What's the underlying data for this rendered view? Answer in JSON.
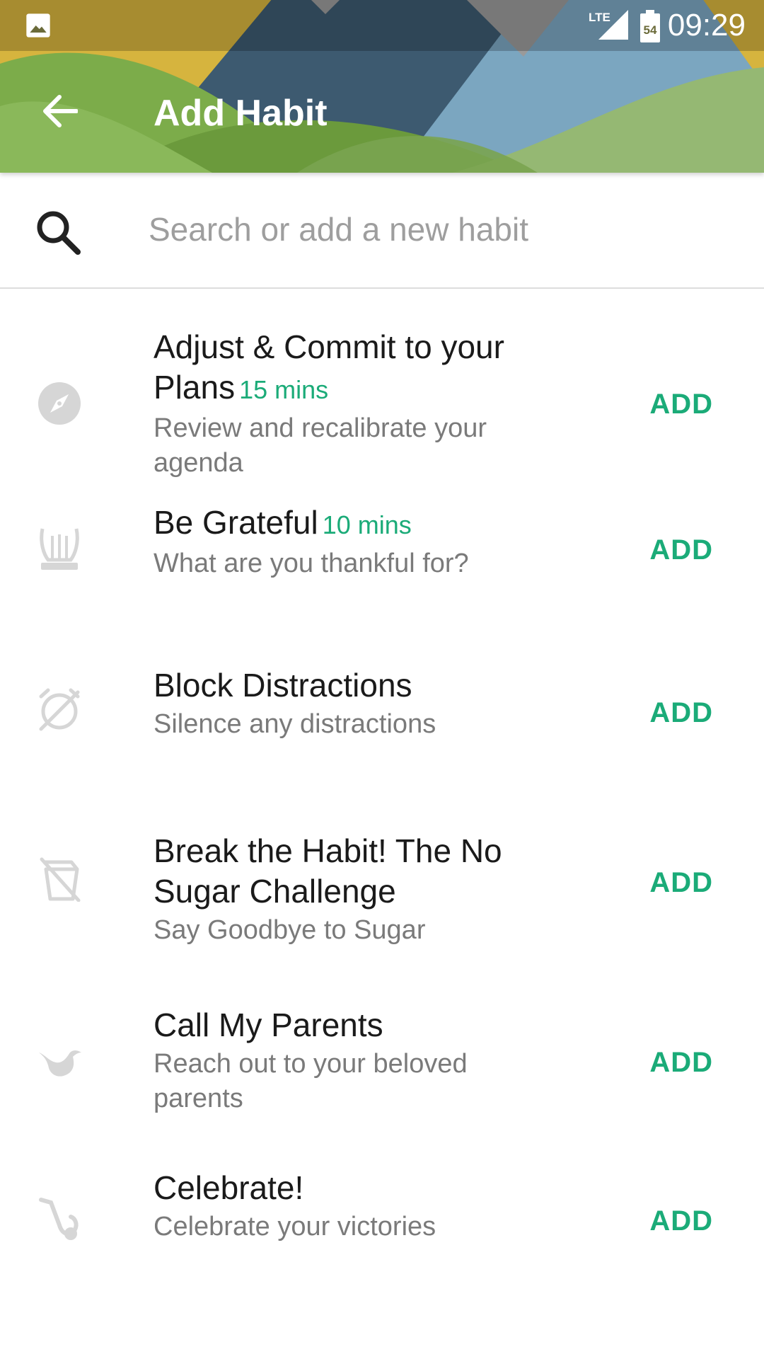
{
  "status_bar": {
    "time": "09:29",
    "network_label": "LTE",
    "battery_level": "54",
    "icons": [
      "image-icon",
      "lte-signal-icon",
      "battery-icon"
    ]
  },
  "toolbar": {
    "title": "Add Habit",
    "back_icon": "arrow-back-icon"
  },
  "search": {
    "placeholder": "Search or add a new habit",
    "value": ""
  },
  "colors": {
    "accent": "#1bab78",
    "title_text": "#1a1a1a",
    "secondary_text": "#7a7a7a",
    "icon_gray": "#d6d6d6"
  },
  "habits": [
    {
      "title": "Adjust & Commit to your Plans",
      "duration": "15 mins",
      "description": "Review and recalibrate your agenda",
      "icon": "compass-icon",
      "action": "ADD"
    },
    {
      "title": "Be Grateful",
      "duration": "10 mins",
      "description": "What are you thankful for?",
      "icon": "lyre-icon",
      "action": "ADD"
    },
    {
      "title": "Block Distractions",
      "duration": "",
      "description": "Silence any distractions",
      "icon": "no-alarm-icon",
      "action": "ADD"
    },
    {
      "title": "Break the Habit! The No Sugar Challenge",
      "duration": "",
      "description": "Say Goodbye to Sugar",
      "icon": "no-sugar-icon",
      "action": "ADD"
    },
    {
      "title": "Call My Parents",
      "duration": "",
      "description": "Reach out to your beloved parents",
      "icon": "bird-icon",
      "action": "ADD"
    },
    {
      "title": "Celebrate!",
      "duration": "",
      "description": "Celebrate your victories",
      "icon": "saxophone-icon",
      "action": "ADD"
    }
  ]
}
